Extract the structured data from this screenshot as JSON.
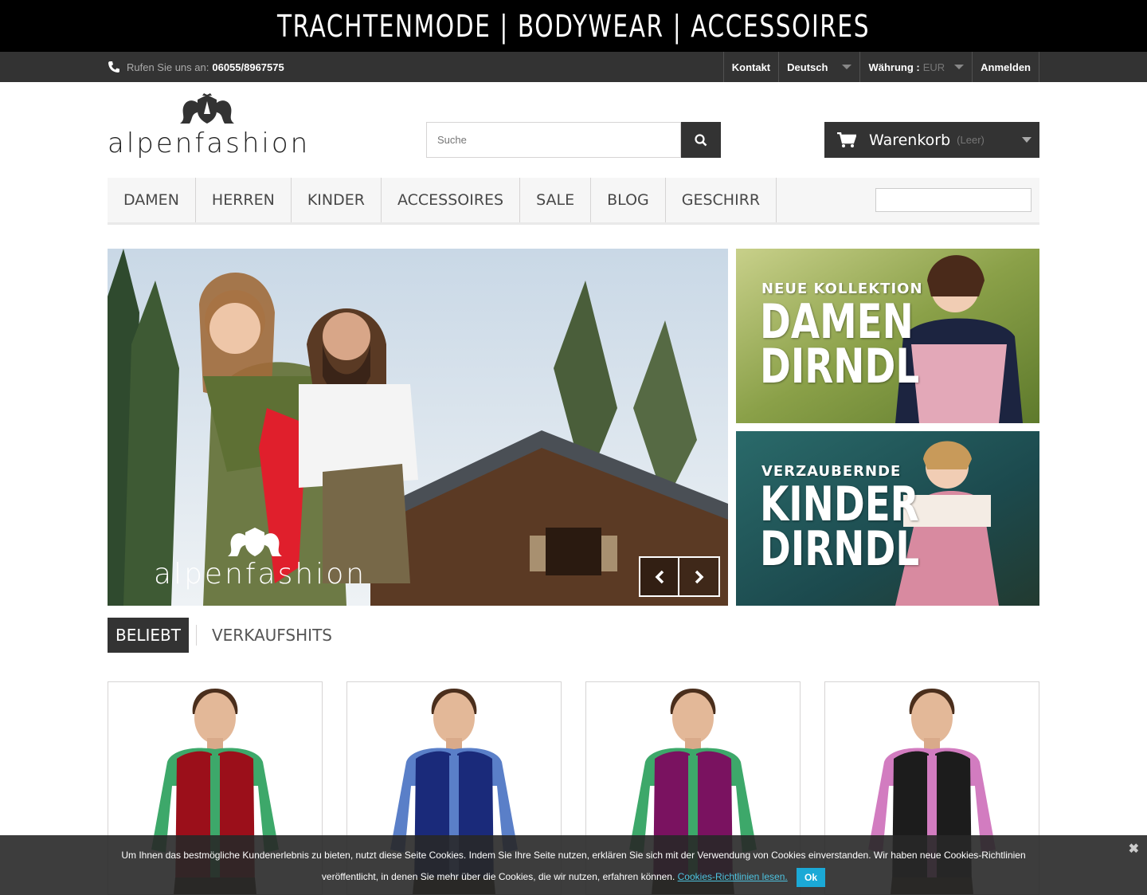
{
  "banner": {
    "text": "TRACHTENMODE | BODYWEAR | ACCESSOIRES"
  },
  "topnav": {
    "phone_prefix": "Rufen Sie uns an:",
    "phone_number": "06055/8967575",
    "contact": "Kontakt",
    "language": "Deutsch",
    "currency_label": "Währung :",
    "currency_value": "EUR",
    "login": "Anmelden"
  },
  "header": {
    "logo_text": "alpenfashion",
    "search_placeholder": "Suche",
    "cart_label": "Warenkorb",
    "cart_status": "(Leer)"
  },
  "menu": {
    "items": [
      "DAMEN",
      "HERREN",
      "KINDER",
      "ACCESSOIRES",
      "SALE",
      "BLOG",
      "GESCHIRR"
    ]
  },
  "slider": {
    "logo_text": "alpenfashion"
  },
  "promos": [
    {
      "small": "NEUE KOLLEKTION",
      "line1": "DAMEN",
      "line2": "DIRNDL"
    },
    {
      "small": "VERZAUBERNDE",
      "line1": "KINDER",
      "line2": "DIRNDL"
    }
  ],
  "tabs": {
    "active": "BELIEBT",
    "inactive": "VERKAUFSHITS"
  },
  "products": [
    {
      "vest_color": "#9b0f1a",
      "shirt_color": "#3da86a"
    },
    {
      "vest_color": "#1a2a7a",
      "shirt_color": "#5a7fc8"
    },
    {
      "vest_color": "#7a1260",
      "shirt_color": "#3da86a"
    },
    {
      "vest_color": "#1c1c1c",
      "shirt_color": "#d27cc0"
    }
  ],
  "cookie": {
    "text1": "Um Ihnen das bestmögliche Kundenerlebnis zu bieten, nutzt diese Seite Cookies. Indem Sie Ihre Seite nutzen, erklären Sie sich mit der Verwendung von Cookies einverstanden. Wir haben neue Cookies-Richtlinien",
    "text2": "veröffentlicht, in denen Sie mehr über die Cookies, die wir nutzen, erfahren können.",
    "link": "Cookies-Richtlinien lesen.",
    "ok": "Ok",
    "close": "✖"
  },
  "colors": {
    "dark": "#333333",
    "accent": "#1ba9d6"
  }
}
